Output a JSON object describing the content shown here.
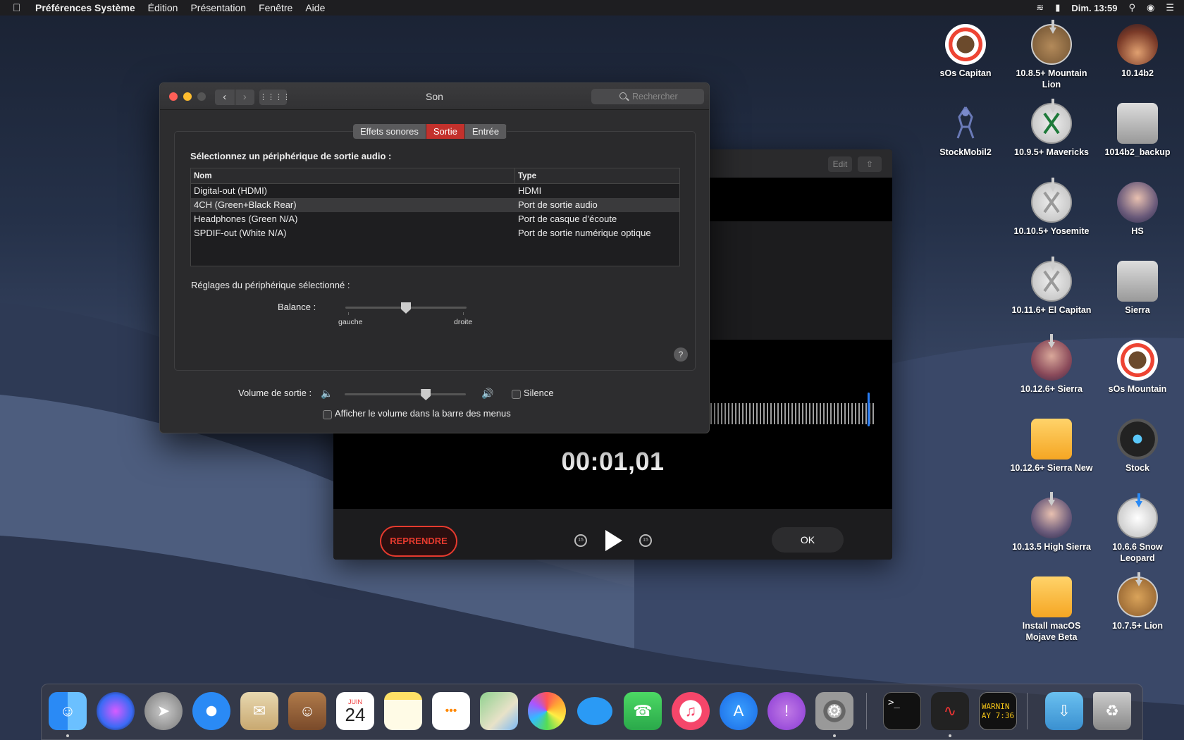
{
  "menubar": {
    "app_name": "Préférences Système",
    "items": [
      "Édition",
      "Présentation",
      "Fenêtre",
      "Aide"
    ],
    "clock": "Dim. 13:59"
  },
  "desktop_icons": [
    {
      "label": "sOs Capitan",
      "icon": "lifebuoy-icon"
    },
    {
      "label": "10.8.5+ Mountain Lion",
      "icon": "mountain-lion-installer-icon"
    },
    {
      "label": "10.14b2",
      "icon": "mojave-icon"
    },
    {
      "label": "StockMobil2",
      "icon": "robot-icon"
    },
    {
      "label": "10.9.5+ Mavericks",
      "icon": "os-x-installer-icon"
    },
    {
      "label": "1014b2_backup",
      "icon": "hard-disk-icon"
    },
    {
      "label": "10.10.5+ Yosemite",
      "icon": "os-x-installer-icon"
    },
    {
      "label": "HS",
      "icon": "high-sierra-icon"
    },
    {
      "label": "10.11.6+ El Capitan",
      "icon": "os-x-installer-icon"
    },
    {
      "label": "Sierra",
      "icon": "hard-disk-icon"
    },
    {
      "label": "10.12.6+ Sierra",
      "icon": "sierra-installer-icon"
    },
    {
      "label": "sOs Mountain",
      "icon": "lifebuoy-icon"
    },
    {
      "label": "10.12.6+ Sierra New",
      "icon": "orange-disk-icon"
    },
    {
      "label": "Stock",
      "icon": "robot-icon"
    },
    {
      "label": "10.13.5 High Sierra",
      "icon": "high-sierra-installer-icon"
    },
    {
      "label": "10.6.6 Snow Leopard",
      "icon": "snow-leopard-installer-icon"
    },
    {
      "label": "Install macOS Mojave Beta",
      "icon": "orange-disk-icon"
    },
    {
      "label": "10.7.5+ Lion",
      "icon": "lion-installer-icon"
    }
  ],
  "sound_window": {
    "title": "Son",
    "search_placeholder": "Rechercher",
    "tabs": [
      "Effets sonores",
      "Sortie",
      "Entrée"
    ],
    "active_tab": "Sortie",
    "section_heading": "Sélectionnez un périphérique de sortie audio :",
    "table_headers": [
      "Nom",
      "Type"
    ],
    "devices": [
      {
        "name": "Digital-out (HDMI)",
        "type": "HDMI",
        "selected": false
      },
      {
        "name": "4CH (Green+Black Rear)",
        "type": "Port de sortie audio",
        "selected": true
      },
      {
        "name": "Headphones (Green N/A)",
        "type": "Port de casque d’écoute",
        "selected": false
      },
      {
        "name": "SPDIF-out (White N/A)",
        "type": "Port de sortie numérique optique",
        "selected": false
      }
    ],
    "device_settings_label": "Réglages du périphérique sélectionné :",
    "balance_label": "Balance :",
    "balance_left": "gauche",
    "balance_right": "droite",
    "balance_value": 0.5,
    "help": "?",
    "volume_label": "Volume de sortie :",
    "volume_value": 0.67,
    "mute_label": "Silence",
    "mute_checked": false,
    "menubar_volume_label": "Afficher le volume dans la barre des menus",
    "menubar_volume_checked": false
  },
  "voice_memos": {
    "edit_label": "Edit",
    "timer": "00:01,01",
    "resume_label": "REPRENDRE",
    "skip_back": "15",
    "skip_forward": "15",
    "ok_label": "OK"
  },
  "dock": {
    "apps": [
      "Finder",
      "Siri",
      "Launchpad",
      "Safari",
      "Mail",
      "Contacts",
      "Calendrier",
      "Notes",
      "Rappels",
      "Plans",
      "Photos",
      "Messages",
      "FaceTime",
      "iTunes",
      "App Store",
      "Feedback",
      "Préférences Système",
      "Terminal",
      "Mémos vocaux",
      "Console",
      "Téléchargements",
      "Corbeille"
    ],
    "calendar_month": "JUIN",
    "calendar_day": "24",
    "console_text": "WARNIN\nAY 7:36"
  }
}
